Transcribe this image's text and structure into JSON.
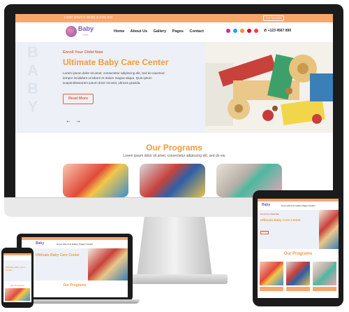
{
  "topbar": {
    "text": "Lorem ipsum is simply dummy text",
    "button": "Our Services"
  },
  "brand": {
    "name": "Baby",
    "sub": "Care"
  },
  "nav": [
    "Home",
    "About Us",
    "Gallery",
    "Pages",
    "Contact"
  ],
  "social": [
    "instagram-icon",
    "twitter-icon",
    "facebook-icon",
    "pinterest-icon",
    "youtube-icon"
  ],
  "phone": "+123 4567 890",
  "hero": {
    "watermark": [
      "B",
      "A",
      "B",
      "Y"
    ],
    "kicker": "Enroll Your Child Now",
    "title": "Ultimate Baby Care Center",
    "text": "Lorem ipsum dolor sit amet, consectetur adipiscing elit, sed do eiusmod tempor incididunt ut labore et dolore magna aliqua. Quis ipsum suspendisseorem ipsum dolor sit amit, ultrices gravida.",
    "button": "Read More",
    "prev": "←",
    "next": "→"
  },
  "programs": {
    "title": "Our Programs",
    "text": "Lorem ipsum dolor sit amet, consectetur adipiscing elit, sed do eiu"
  },
  "colors": {
    "accent": "#f9a56e",
    "title": "#f39a3a",
    "cta": "#e8613b",
    "brand": "#7a55c4"
  }
}
